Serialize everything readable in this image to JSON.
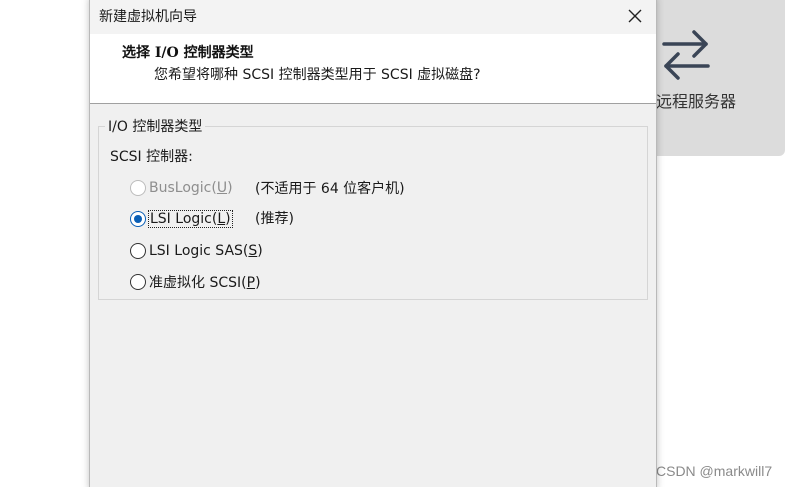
{
  "background_card": {
    "label": "远程服务器",
    "icon": "swap-arrows-icon"
  },
  "watermark": "CSDN @markwill7",
  "dialog": {
    "title": "新建虚拟机向导",
    "close_icon": "close-icon",
    "header_title": "选择 I/O 控制器类型",
    "header_subtitle": "您希望将哪种 SCSI 控制器类型用于 SCSI 虚拟磁盘?",
    "group_legend": "I/O 控制器类型",
    "controller_label": "SCSI 控制器:",
    "options": [
      {
        "name": "BusLogic",
        "mnemonic": "U",
        "selected": false,
        "enabled": false,
        "note": "(不适用于 64 位客户机)"
      },
      {
        "name": "LSI Logic",
        "mnemonic": "L",
        "selected": true,
        "enabled": true,
        "note": "(推荐)"
      },
      {
        "name": "LSI Logic SAS",
        "mnemonic": "S",
        "selected": false,
        "enabled": true,
        "note": ""
      },
      {
        "name": "准虚拟化 SCSI",
        "mnemonic": "P",
        "selected": false,
        "enabled": true,
        "note": ""
      }
    ]
  },
  "colors": {
    "accent": "#0a5fb6",
    "dialog_bg": "#f0f0f0",
    "card_bg": "#dcdcdc"
  }
}
